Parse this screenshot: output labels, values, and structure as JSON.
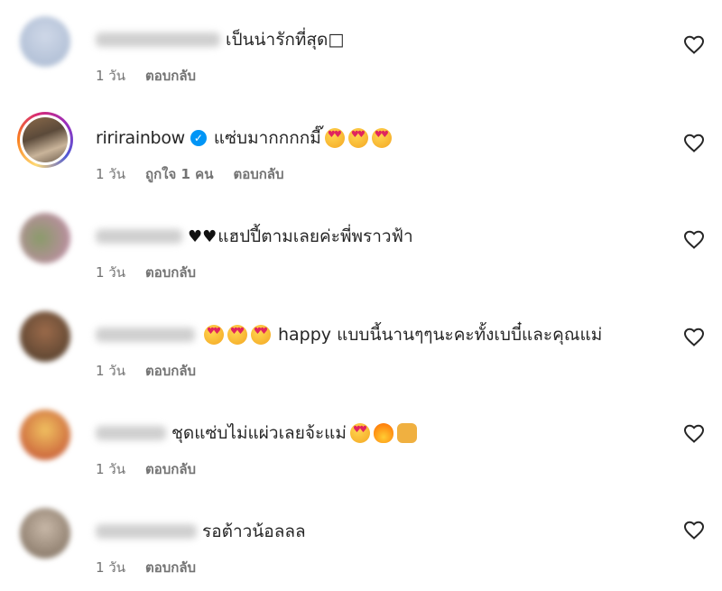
{
  "comments": [
    {
      "text": "เป็นน่ารักที่สุด□",
      "time": "1 วัน",
      "reply": "ตอบกลับ",
      "likes": ""
    },
    {
      "username": "ririrainbow",
      "text": "แซ่บมากกกกมี๊",
      "time": "1 วัน",
      "likes": "ถูกใจ 1 คน",
      "reply": "ตอบกลับ"
    },
    {
      "text": "แฮปปี้ตามเลยค่ะพี่พราวฟ้า",
      "time": "1 วัน",
      "reply": "ตอบกลับ",
      "likes": ""
    },
    {
      "text": "happy แบบนี้นานๆๆนะคะทั้งเบบี๋และคุณแม่",
      "time": "1 วัน",
      "reply": "ตอบกลับ",
      "likes": ""
    },
    {
      "text": "ชุดแซ่บไม่แผ่วเลยจ้ะแม่",
      "time": "1 วัน",
      "reply": "ตอบกลับ",
      "likes": ""
    },
    {
      "text": "รอต้าวน้อลลล",
      "time": "1 วัน",
      "reply": "ตอบกลับ",
      "likes": ""
    }
  ],
  "icons": {
    "like": "heart-outline-icon",
    "verified": "verified-badge-icon"
  },
  "colors": {
    "verified": "#0095f6",
    "meta_text": "#737373"
  }
}
